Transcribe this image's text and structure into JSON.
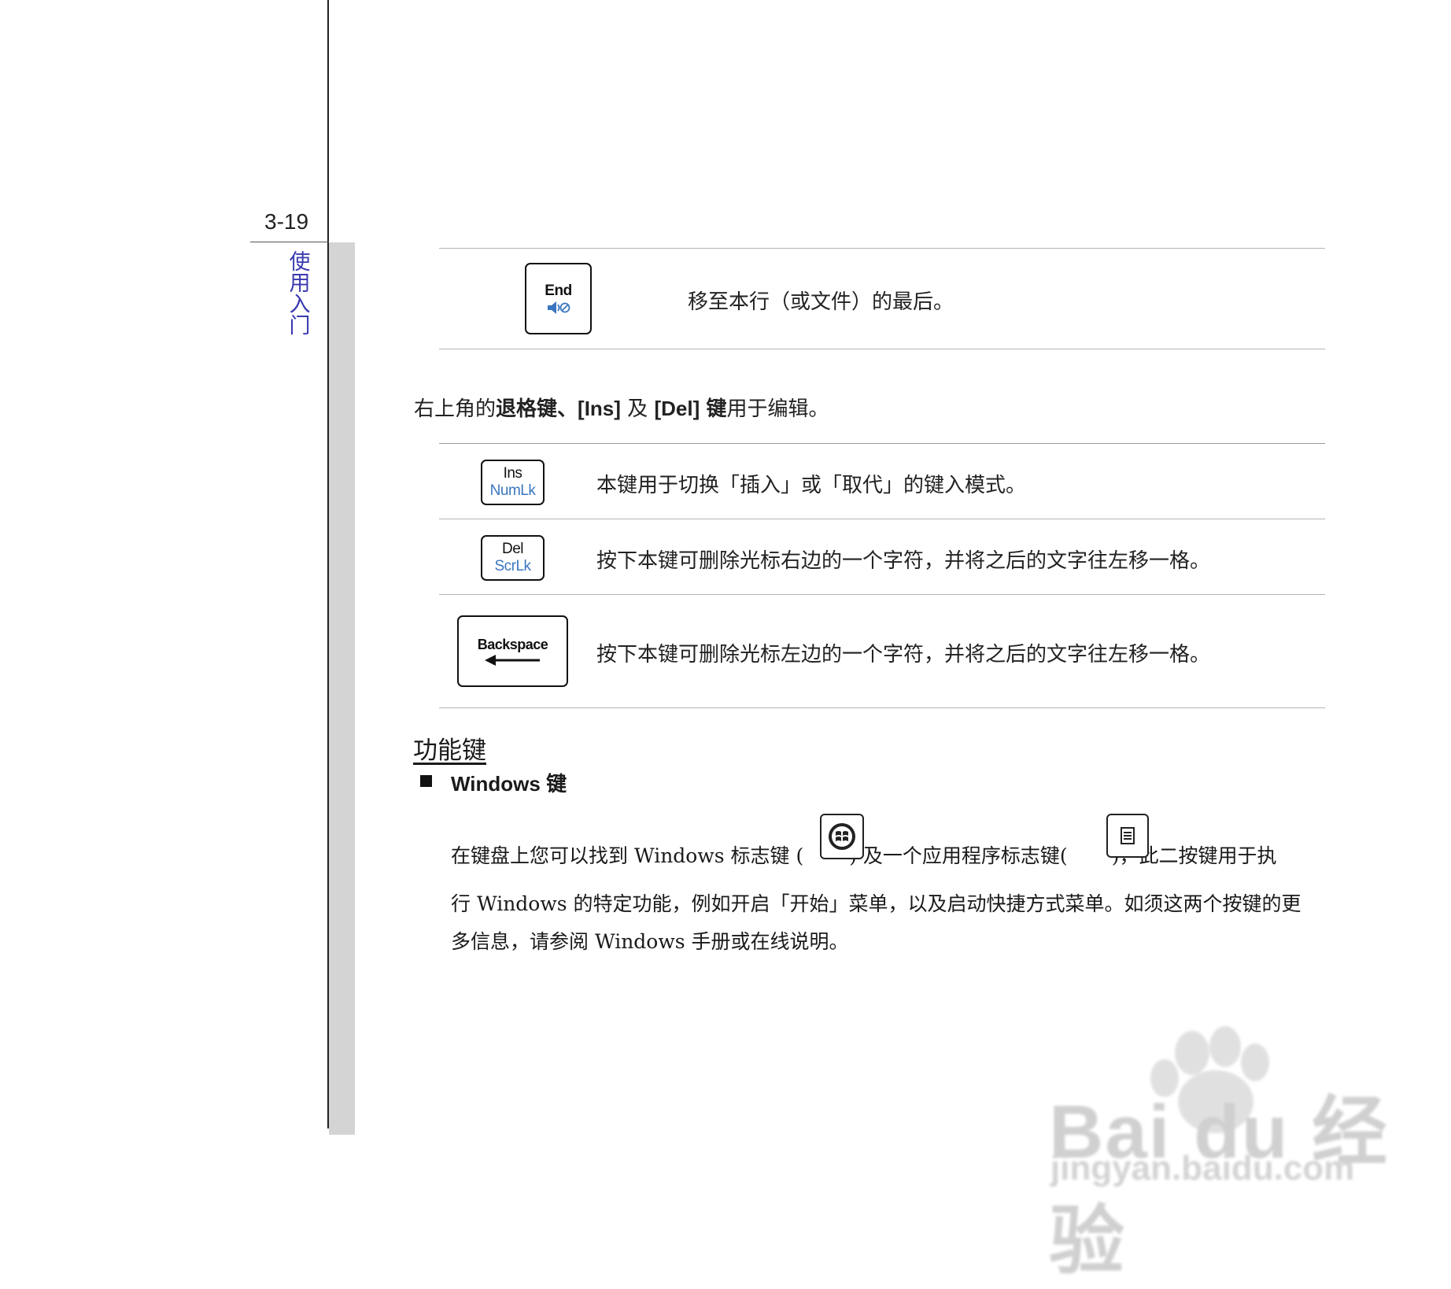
{
  "page": {
    "number": "3-19",
    "chapter": "使用入门"
  },
  "end_key": {
    "label": "End",
    "description": "移至本行（或文件）的最后。"
  },
  "intro": {
    "prefix": "右上角的",
    "backspace_word": "退格键、",
    "ins": "[Ins]",
    "and": "及",
    "del": "[Del]",
    "key_word": "键",
    "suffix": "用于编辑。"
  },
  "edit_keys": [
    {
      "top": "Ins",
      "bottom": "NumLk",
      "description": "本键用于切换「插入」或「取代」的键入模式。"
    },
    {
      "top": "Del",
      "bottom": "ScrLk",
      "description": "按下本键可删除光标右边的一个字符，并将之后的文字往左移一格。"
    },
    {
      "top": "Backspace",
      "bottom": "",
      "description": "按下本键可删除光标左边的一个字符，并将之后的文字往左移一格。"
    }
  ],
  "section": {
    "heading": "功能键",
    "windows_heading": "Windows 键",
    "line1_a": "在键盘上您可以找到 Windows 标志键 (",
    "line1_b": ") 及一个应用程序标志键(",
    "line1_c": ")，此二按键用于执",
    "line2": "行 Windows 的特定功能，例如开启「开始」菜单，以及启动快捷方式菜单。如须这两个按键的更",
    "line3": "多信息，请参阅 Windows 手册或在线说明。"
  },
  "watermark": {
    "logo": "Bai du 经验",
    "url": "jingyan.baidu.com"
  },
  "icons": {
    "speaker_mute": "speaker-mute-icon",
    "windows_logo": "windows-logo-icon",
    "app_menu": "app-menu-icon",
    "arrow": "left-arrow-icon"
  }
}
